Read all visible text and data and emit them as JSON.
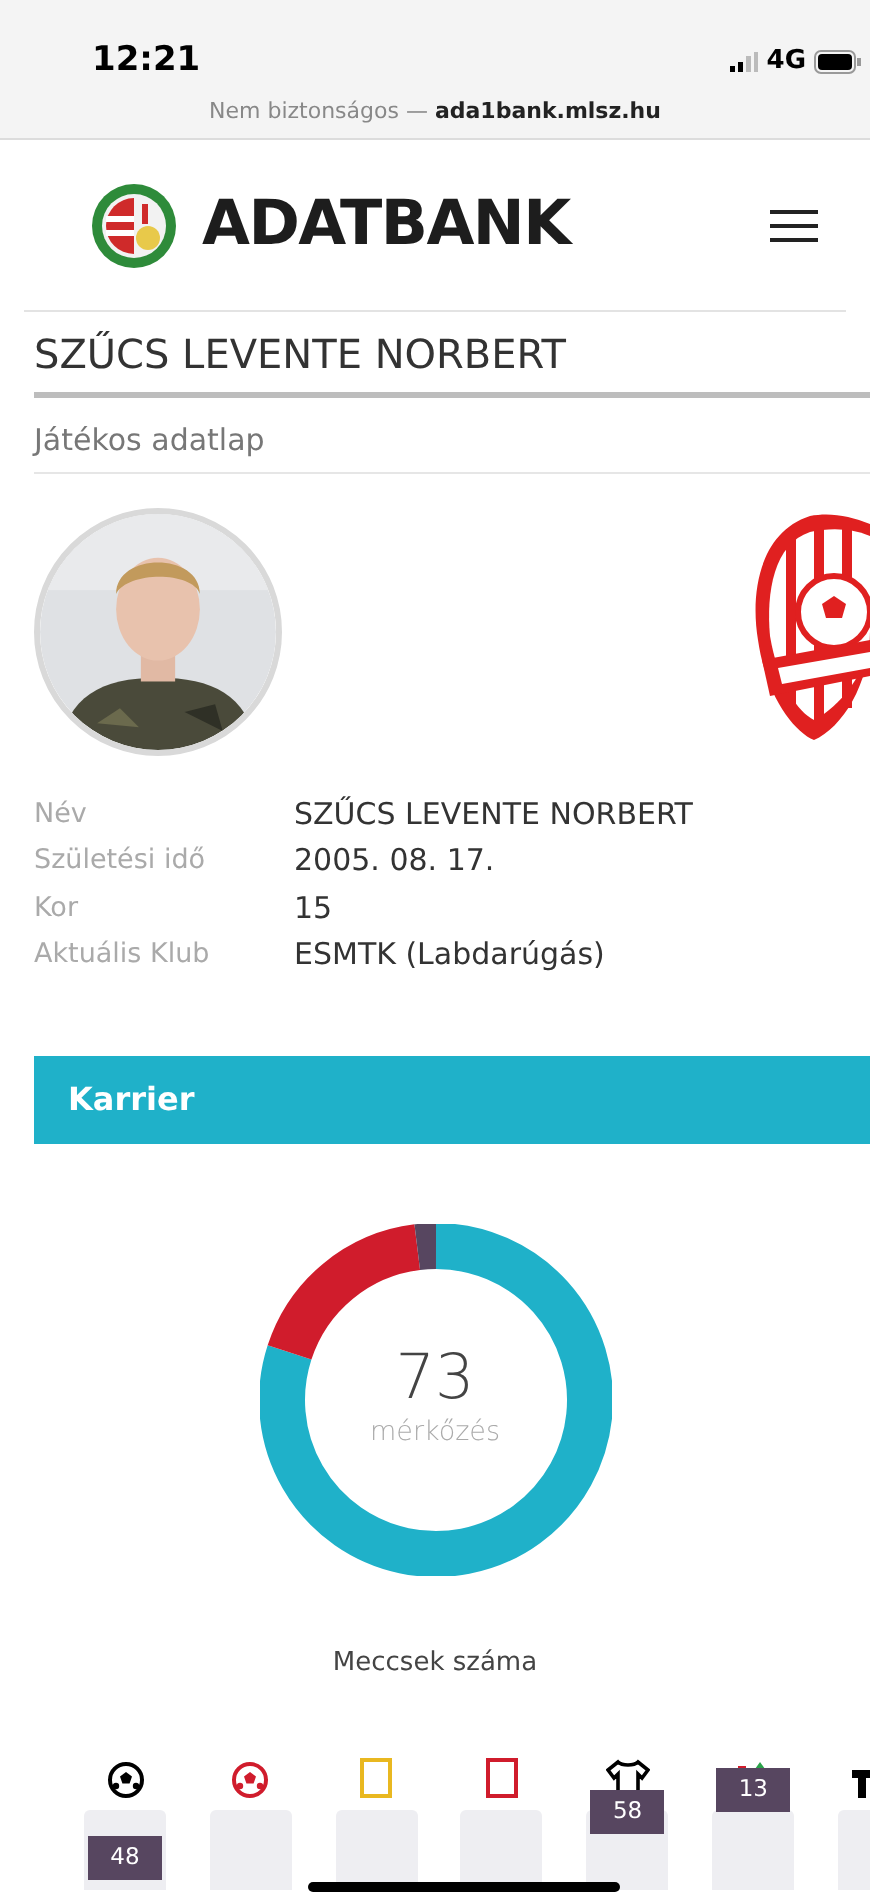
{
  "status_bar": {
    "time": "12:21",
    "network": "4G"
  },
  "browser": {
    "security": "Nem biztonságos —",
    "host": "ada1bank.mlsz.hu"
  },
  "header": {
    "title": "ADATBANK"
  },
  "player": {
    "heading": "SZŰCS LEVENTE NORBERT",
    "subheading": "Játékos adatlap",
    "details": [
      {
        "label": "Név",
        "value": "SZŰCS LEVENTE NORBERT"
      },
      {
        "label": "Születési idő",
        "value": "2005. 08. 17."
      },
      {
        "label": "Kor",
        "value": "15"
      },
      {
        "label": "Aktuális Klub",
        "value": "ESMTK (Labdarúgás)"
      }
    ]
  },
  "career": {
    "title": "Karrier",
    "total": "73",
    "total_label": "mérkőzés",
    "caption": "Meccsek száma"
  },
  "stats": [
    {
      "kind": "goal",
      "value": "48"
    },
    {
      "kind": "own_goal"
    },
    {
      "kind": "yellow_card"
    },
    {
      "kind": "red_card"
    },
    {
      "kind": "starting",
      "value": "58"
    },
    {
      "kind": "substitute",
      "value": "13"
    },
    {
      "kind": "bench"
    }
  ]
}
